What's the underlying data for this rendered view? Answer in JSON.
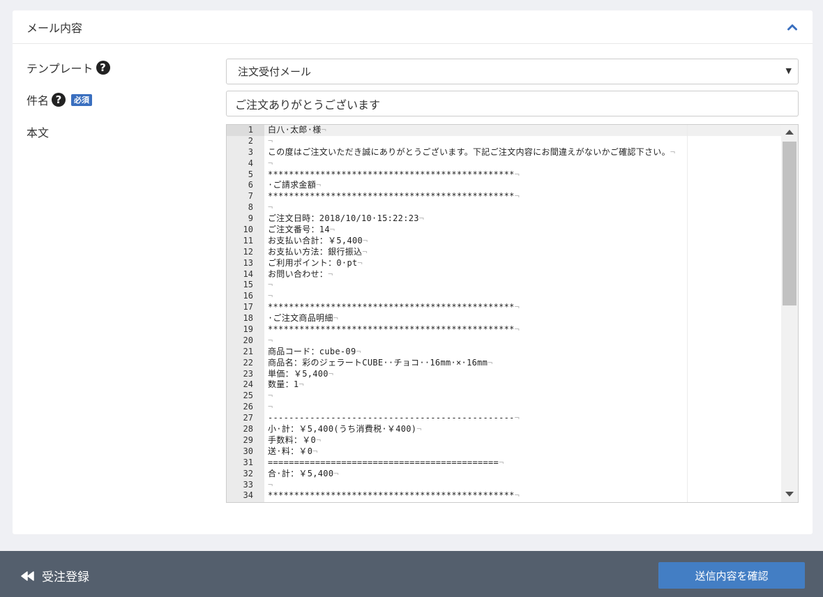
{
  "card": {
    "title": "メール内容",
    "collapse_icon": "chevron-up-icon"
  },
  "form": {
    "template": {
      "label": "テンプレート",
      "help_icon": "question-circle-icon",
      "selected": "注文受付メール"
    },
    "subject": {
      "label": "件名",
      "help_icon": "question-circle-icon",
      "required_badge": "必須",
      "value": "ご注文ありがとうございます"
    },
    "body": {
      "label": "本文"
    }
  },
  "editor": {
    "eol_marker": "¬",
    "lines": [
      "白八·太郎·様",
      "",
      "この度はご注文いただき誠にありがとうございます。下記ご注文内容にお間違えがないかご確認下さい。",
      "",
      "***********************************************",
      "·ご請求金額",
      "***********************************************",
      "",
      "ご注文日時：2018/10/10·15:22:23",
      "ご注文番号：14",
      "お支払い合計：￥5,400",
      "お支払い方法：銀行振込",
      "ご利用ポイント：0·pt",
      "お問い合わせ：",
      "",
      "",
      "***********************************************",
      "·ご注文商品明細",
      "***********************************************",
      "",
      "商品コード：cube-09",
      "商品名：彩のジェラートCUBE··チョコ··16mm·×·16mm",
      "単価：￥5,400",
      "数量：1",
      "",
      "",
      "-----------------------------------------------",
      "小·計：￥5,400(うち消費税·￥400)",
      "手数料：￥0",
      "送·料：￥0",
      "============================================",
      "合·計：￥5,400",
      "",
      "***********************************************"
    ]
  },
  "footer": {
    "back_label": "受注登録",
    "back_icon": "backward-icon",
    "confirm_label": "送信内容を確認"
  },
  "colors": {
    "footer_bg": "#545f6d",
    "primary_button": "#437ec4",
    "required_badge": "#3a6fbf",
    "page_bg": "#eff0f4"
  }
}
